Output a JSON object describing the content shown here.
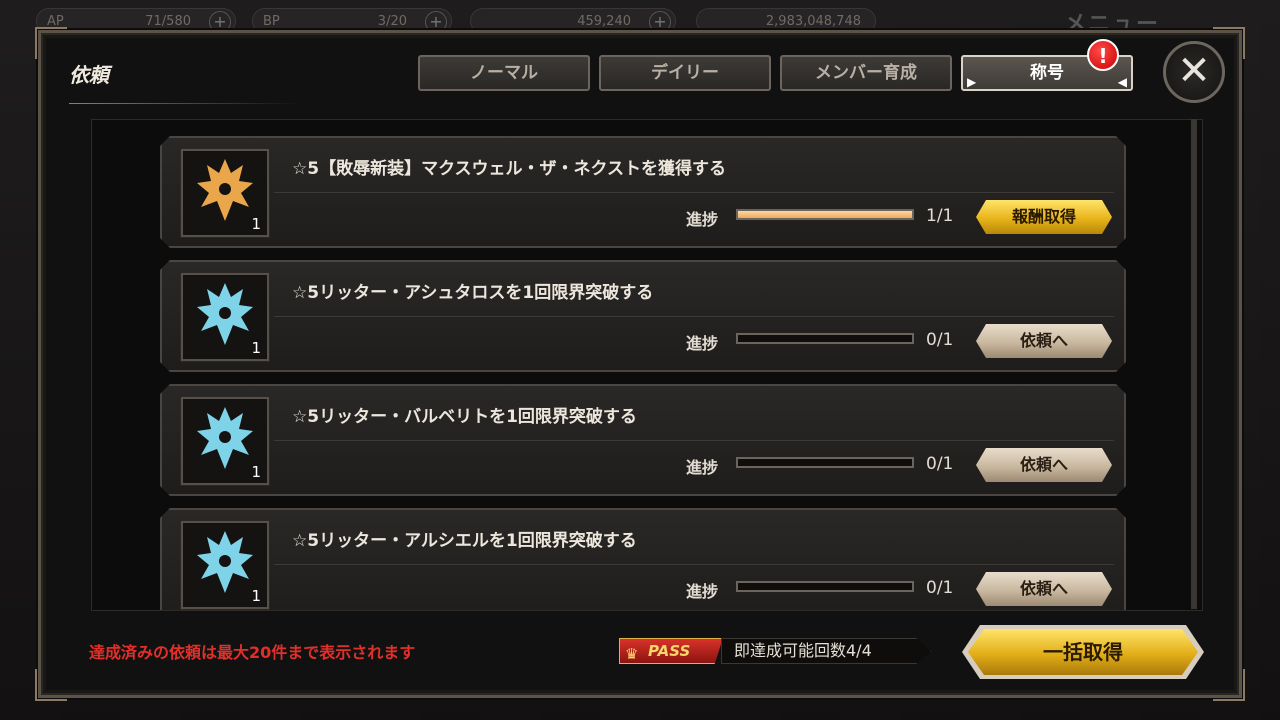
{
  "topbar": {
    "stats": [
      {
        "label": "AP",
        "value": "71/580"
      },
      {
        "label": "BP",
        "value": "3/20"
      },
      {
        "label": "",
        "value": "459,240"
      },
      {
        "label": "",
        "value": "2,983,048,748"
      }
    ],
    "menu_label": "メニュー"
  },
  "panel": {
    "title": "依頼",
    "tabs": [
      {
        "label": "ノーマル",
        "active": false
      },
      {
        "label": "デイリー",
        "active": false
      },
      {
        "label": "メンバー育成",
        "active": false
      },
      {
        "label": "称号",
        "active": true
      }
    ],
    "alert_badge": "!",
    "close_icon": "close-icon"
  },
  "quests": [
    {
      "title": "☆5【敗辱新装】マクスウェル・ザ・ネクストを獲得する",
      "count": "1",
      "progress_label": "進捗",
      "progress": 1.0,
      "ratio": "1/1",
      "button": "報酬取得",
      "button_style": "gold",
      "icon_color": "#e9a64a"
    },
    {
      "title": "☆5リッター・アシュタロスを1回限界突破する",
      "count": "1",
      "progress_label": "進捗",
      "progress": 0.0,
      "ratio": "0/1",
      "button": "依頼へ",
      "button_style": "beige",
      "icon_color": "#7fd3e8"
    },
    {
      "title": "☆5リッター・バルベリトを1回限界突破する",
      "count": "1",
      "progress_label": "進捗",
      "progress": 0.0,
      "ratio": "0/1",
      "button": "依頼へ",
      "button_style": "beige",
      "icon_color": "#7fd3e8"
    },
    {
      "title": "☆5リッター・アルシエルを1回限界突破する",
      "count": "1",
      "progress_label": "進捗",
      "progress": 0.0,
      "ratio": "0/1",
      "button": "依頼へ",
      "button_style": "beige",
      "icon_color": "#7fd3e8"
    }
  ],
  "footer": {
    "note": "達成済みの依頼は最大20件まで表示されます",
    "pass_label": "PASS",
    "pass_text": "即達成可能回数4/4",
    "collect_all": "一括取得"
  }
}
